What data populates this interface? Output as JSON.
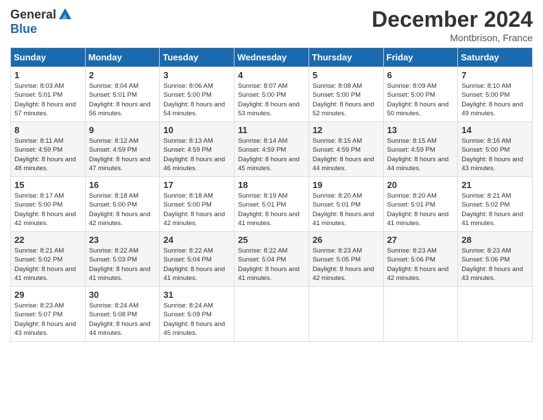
{
  "header": {
    "logo_general": "General",
    "logo_blue": "Blue",
    "month_title": "December 2024",
    "location": "Montbrison, France"
  },
  "days_of_week": [
    "Sunday",
    "Monday",
    "Tuesday",
    "Wednesday",
    "Thursday",
    "Friday",
    "Saturday"
  ],
  "weeks": [
    [
      {
        "day": "1",
        "sunrise": "8:03 AM",
        "sunset": "5:01 PM",
        "daylight": "8 hours and 57 minutes."
      },
      {
        "day": "2",
        "sunrise": "8:04 AM",
        "sunset": "5:01 PM",
        "daylight": "8 hours and 56 minutes."
      },
      {
        "day": "3",
        "sunrise": "8:06 AM",
        "sunset": "5:00 PM",
        "daylight": "8 hours and 54 minutes."
      },
      {
        "day": "4",
        "sunrise": "8:07 AM",
        "sunset": "5:00 PM",
        "daylight": "8 hours and 53 minutes."
      },
      {
        "day": "5",
        "sunrise": "8:08 AM",
        "sunset": "5:00 PM",
        "daylight": "8 hours and 52 minutes."
      },
      {
        "day": "6",
        "sunrise": "8:09 AM",
        "sunset": "5:00 PM",
        "daylight": "8 hours and 50 minutes."
      },
      {
        "day": "7",
        "sunrise": "8:10 AM",
        "sunset": "5:00 PM",
        "daylight": "8 hours and 49 minutes."
      }
    ],
    [
      {
        "day": "8",
        "sunrise": "8:11 AM",
        "sunset": "4:59 PM",
        "daylight": "8 hours and 48 minutes."
      },
      {
        "day": "9",
        "sunrise": "8:12 AM",
        "sunset": "4:59 PM",
        "daylight": "8 hours and 47 minutes."
      },
      {
        "day": "10",
        "sunrise": "8:13 AM",
        "sunset": "4:59 PM",
        "daylight": "8 hours and 46 minutes."
      },
      {
        "day": "11",
        "sunrise": "8:14 AM",
        "sunset": "4:59 PM",
        "daylight": "8 hours and 45 minutes."
      },
      {
        "day": "12",
        "sunrise": "8:15 AM",
        "sunset": "4:59 PM",
        "daylight": "8 hours and 44 minutes."
      },
      {
        "day": "13",
        "sunrise": "8:15 AM",
        "sunset": "4:59 PM",
        "daylight": "8 hours and 44 minutes."
      },
      {
        "day": "14",
        "sunrise": "8:16 AM",
        "sunset": "5:00 PM",
        "daylight": "8 hours and 43 minutes."
      }
    ],
    [
      {
        "day": "15",
        "sunrise": "8:17 AM",
        "sunset": "5:00 PM",
        "daylight": "8 hours and 42 minutes."
      },
      {
        "day": "16",
        "sunrise": "8:18 AM",
        "sunset": "5:00 PM",
        "daylight": "8 hours and 42 minutes."
      },
      {
        "day": "17",
        "sunrise": "8:18 AM",
        "sunset": "5:00 PM",
        "daylight": "8 hours and 42 minutes."
      },
      {
        "day": "18",
        "sunrise": "8:19 AM",
        "sunset": "5:01 PM",
        "daylight": "8 hours and 41 minutes."
      },
      {
        "day": "19",
        "sunrise": "8:20 AM",
        "sunset": "5:01 PM",
        "daylight": "8 hours and 41 minutes."
      },
      {
        "day": "20",
        "sunrise": "8:20 AM",
        "sunset": "5:01 PM",
        "daylight": "8 hours and 41 minutes."
      },
      {
        "day": "21",
        "sunrise": "8:21 AM",
        "sunset": "5:02 PM",
        "daylight": "8 hours and 41 minutes."
      }
    ],
    [
      {
        "day": "22",
        "sunrise": "8:21 AM",
        "sunset": "5:02 PM",
        "daylight": "8 hours and 41 minutes."
      },
      {
        "day": "23",
        "sunrise": "8:22 AM",
        "sunset": "5:03 PM",
        "daylight": "8 hours and 41 minutes."
      },
      {
        "day": "24",
        "sunrise": "8:22 AM",
        "sunset": "5:04 PM",
        "daylight": "8 hours and 41 minutes."
      },
      {
        "day": "25",
        "sunrise": "8:22 AM",
        "sunset": "5:04 PM",
        "daylight": "8 hours and 41 minutes."
      },
      {
        "day": "26",
        "sunrise": "8:23 AM",
        "sunset": "5:05 PM",
        "daylight": "8 hours and 42 minutes."
      },
      {
        "day": "27",
        "sunrise": "8:23 AM",
        "sunset": "5:06 PM",
        "daylight": "8 hours and 42 minutes."
      },
      {
        "day": "28",
        "sunrise": "8:23 AM",
        "sunset": "5:06 PM",
        "daylight": "8 hours and 43 minutes."
      }
    ],
    [
      {
        "day": "29",
        "sunrise": "8:23 AM",
        "sunset": "5:07 PM",
        "daylight": "8 hours and 43 minutes."
      },
      {
        "day": "30",
        "sunrise": "8:24 AM",
        "sunset": "5:08 PM",
        "daylight": "8 hours and 44 minutes."
      },
      {
        "day": "31",
        "sunrise": "8:24 AM",
        "sunset": "5:09 PM",
        "daylight": "8 hours and 45 minutes."
      },
      null,
      null,
      null,
      null
    ]
  ]
}
